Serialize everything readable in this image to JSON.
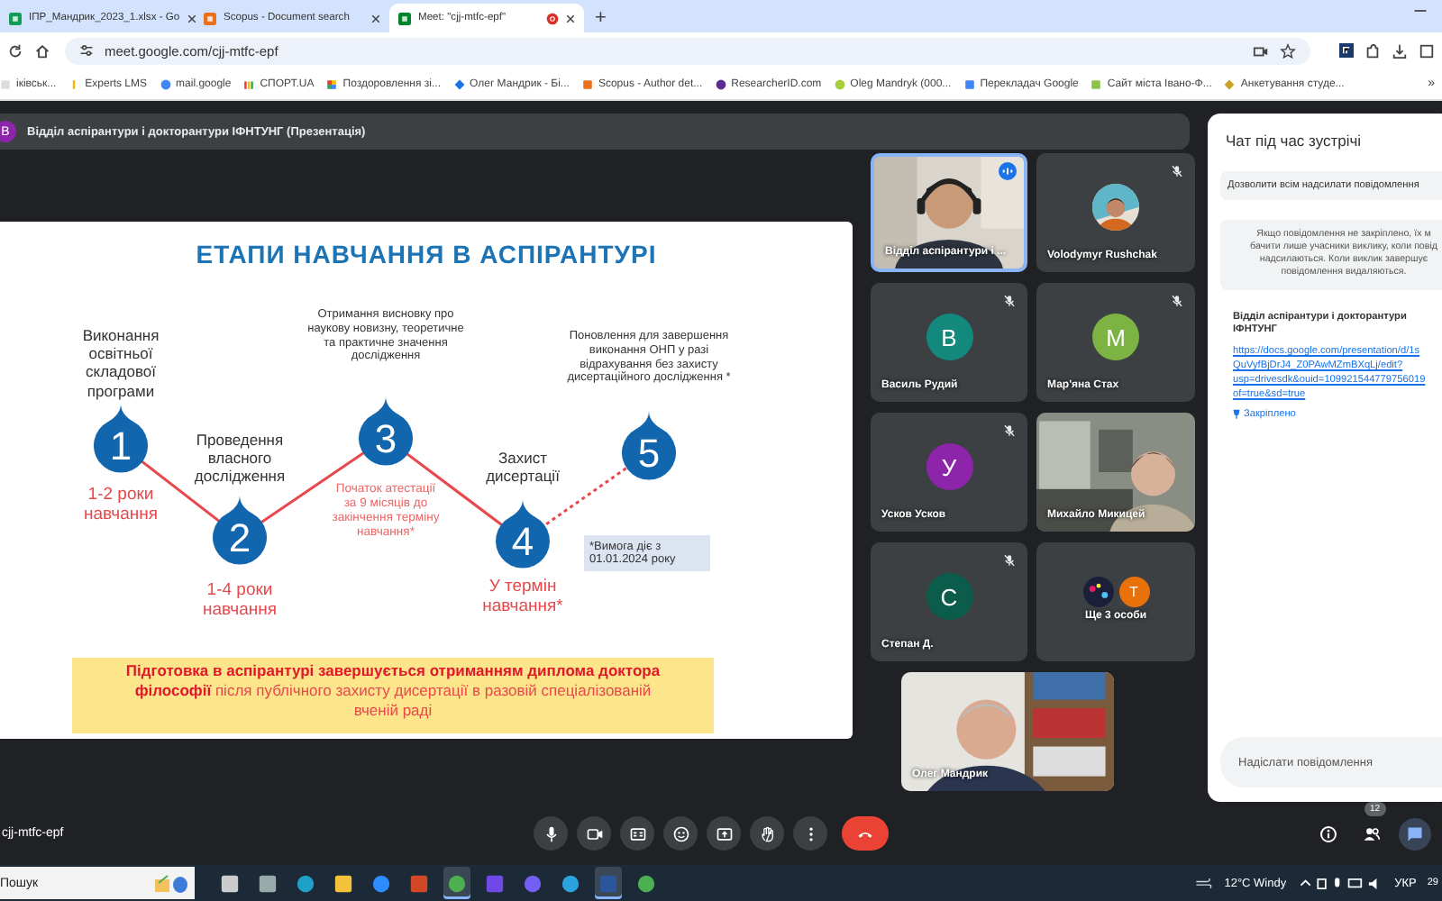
{
  "browser": {
    "tabs": [
      {
        "title": "ІПР_Мандрик_2023_1.xlsx - Go",
        "kind": "sheets",
        "selected": false,
        "recording": false
      },
      {
        "title": "Scopus - Document search",
        "kind": "scopus",
        "selected": false,
        "recording": false
      },
      {
        "title": "Meet: \"cjj-mtfc-epf\"",
        "kind": "meet",
        "selected": true,
        "recording": true
      }
    ],
    "new_tab": "+",
    "address": "meet.google.com/cjj-mtfc-epf",
    "bookmarks": [
      {
        "label": "іківськ...",
        "kind": "blank"
      },
      {
        "label": "Experts LMS",
        "kind": "lms"
      },
      {
        "label": "mail.google",
        "kind": "google"
      },
      {
        "label": "СПОРТ.UA",
        "kind": "bars"
      },
      {
        "label": "Поздоровлення зі...",
        "kind": "grid"
      },
      {
        "label": "Олег Мандрик - Бі...",
        "kind": "shield"
      },
      {
        "label": "Scopus - Author det...",
        "kind": "scopus"
      },
      {
        "label": "ResearcherID.com",
        "kind": "rid"
      },
      {
        "label": "Oleg Mandryk (000...",
        "kind": "orcid"
      },
      {
        "label": "Перекладач Google",
        "kind": "translate"
      },
      {
        "label": "Сайт міста Івано-Ф...",
        "kind": "city"
      },
      {
        "label": "Анкетування студе...",
        "kind": "emblem"
      }
    ],
    "overflow": "»"
  },
  "presentation": {
    "avatar": "В",
    "title": "Відділ аспірантури і докторантури ІФНТУНГ (Презентація)"
  },
  "slide": {
    "title": "ЕТАПИ НАВЧАННЯ В АСПІРАНТУРІ",
    "stages": [
      {
        "number": "1",
        "label": "Виконання освітньої складової програми",
        "term": "1-2 роки навчання"
      },
      {
        "number": "2",
        "label": "Проведення власного дослідження",
        "term": "1-4 роки навчання"
      },
      {
        "number": "3",
        "label": "Отримання висновку про наукову новизну, теоретичне та практичне значення дослідження",
        "term": "Початок атестації за 9 місяців до закінчення терміну навчання*"
      },
      {
        "number": "4",
        "label": "Захист дисертації",
        "term": "У термін навчання*"
      },
      {
        "number": "5",
        "label": "Поновлення для завершення виконання ОНП у разі відрахування без захисту дисертаційного дослідження *",
        "term": "*Вимога діє з 01.01.2024 року"
      }
    ],
    "conclusion": "**Підготовка в аспірантурі завершується отриманням диплома доктора філософії** після публічного захисту дисертації в разовій спеціалізованій вченій раді"
  },
  "participants": [
    {
      "name": "Відділ аспірантури і ...",
      "kind": "video",
      "muted": false,
      "speaking": true
    },
    {
      "name": "Volodymyr Rushchak",
      "muted": true,
      "speaking": false
    },
    {
      "name": "Василь Рудий",
      "kind": "letter",
      "letter": "В",
      "color": "#12897c",
      "muted": true,
      "speaking": false
    },
    {
      "name": "Мар'яна Стах",
      "kind": "letter",
      "letter": "М",
      "color": "#7cb342",
      "muted": true,
      "speaking": false
    },
    {
      "name": "Усков Усков",
      "kind": "letter",
      "letter": "У",
      "color": "#8e24aa",
      "muted": true,
      "speaking": false
    },
    {
      "name": "Михайло Микицей",
      "kind": "video",
      "muted": false,
      "speaking": false
    },
    {
      "name": "Степан Д.",
      "kind": "letter",
      "letter": "С",
      "color": "#0b5c4b",
      "muted": true,
      "speaking": false
    },
    {
      "name": "Ще 3 особи",
      "kind": "more",
      "letter": "Т",
      "color": "#e8710a",
      "muted": false,
      "speaking": false
    }
  ],
  "self_view": {
    "name": "Олег Мандрик"
  },
  "chat": {
    "title": "Чат під час зустрічі",
    "setting": "Дозволити всім надсилати повідомлення",
    "notice": [
      "Якщо повідомлення не закріплено, їх м",
      "бачити лише учасники виклику, коли повід",
      "надсилаються. Коли виклик завершує",
      "повідомлення видаляються."
    ],
    "message": {
      "sender": "Відділ аспірантури і докторантури ІФНТУНГ",
      "link": [
        "https://docs.google.com/presentation/d/1s",
        "QuVyfBjDrJ4_Z0PAwMZmBXqLj/edit?",
        "usp=drivesdk&ouid=109921544779756019",
        "of=true&sd=true"
      ],
      "pinned": "Закріплено"
    },
    "placeholder": "Надіслати повідомлення"
  },
  "meeting_code": "cjj-mtfc-epf",
  "controls": [
    {
      "kind": "mic"
    },
    {
      "kind": "camera"
    },
    {
      "kind": "captions"
    },
    {
      "kind": "emoji"
    },
    {
      "kind": "present"
    },
    {
      "kind": "hand"
    },
    {
      "kind": "more"
    },
    {
      "kind": "hangup"
    }
  ],
  "side_controls": [
    {
      "kind": "info",
      "selected": false
    },
    {
      "kind": "people",
      "badge": "12",
      "selected": false
    },
    {
      "kind": "chat",
      "selected": true
    }
  ],
  "taskbar": {
    "search": "Пошук",
    "apps": [
      {
        "kind": "taskview",
        "active": false
      },
      {
        "kind": "tool",
        "active": false
      },
      {
        "kind": "edge",
        "active": false
      },
      {
        "kind": "folder",
        "active": false
      },
      {
        "kind": "zoom",
        "active": false
      },
      {
        "kind": "ppt",
        "active": false
      },
      {
        "kind": "chrome",
        "active": true
      },
      {
        "kind": "save",
        "active": false
      },
      {
        "kind": "viber",
        "active": false
      },
      {
        "kind": "telegram",
        "active": false
      },
      {
        "kind": "word",
        "active": true
      },
      {
        "kind": "chrome",
        "active": false
      }
    ],
    "weather": "12°C  Windy",
    "language": "УКР",
    "clock": "29"
  }
}
